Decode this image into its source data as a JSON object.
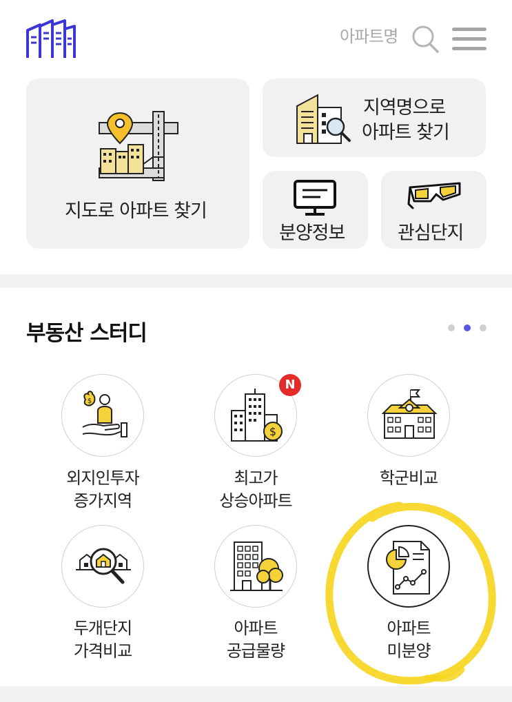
{
  "header": {
    "search_label": "아파트명",
    "logo_icon": "buildings-logo-icon",
    "search_icon": "search-icon",
    "menu_icon": "hamburger-menu-icon",
    "brand_color": "#3a35d6"
  },
  "tiles": {
    "map": {
      "label": "지도로 아파트 찾기",
      "icon": "map-pin-icon"
    },
    "region": {
      "line1": "지역명으로",
      "line2": "아파트 찾기",
      "icon": "building-magnifier-icon"
    },
    "sale_info": {
      "label": "분양정보",
      "icon": "monitor-icon"
    },
    "interest": {
      "label": "관심단지",
      "icon": "3d-glasses-icon"
    }
  },
  "study": {
    "title": "부동산 스터디",
    "page_indicator": {
      "total": 3,
      "active": 2,
      "active_color": "#5b57e6",
      "inactive_color": "#cfcfcf"
    },
    "items": [
      {
        "line1": "외지인투자",
        "line2": "증가지역",
        "icon": "investor-money-icon"
      },
      {
        "line1": "최고가",
        "line2": "상승아파트",
        "icon": "tower-coin-icon",
        "badge": "N"
      },
      {
        "line1": "학군비교",
        "line2": "",
        "icon": "school-icon"
      },
      {
        "line1": "두개단지",
        "line2": "가격비교",
        "icon": "house-magnifier-icon"
      },
      {
        "line1": "아파트",
        "line2": "공급물량",
        "icon": "apartment-tree-icon"
      },
      {
        "line1": "아파트",
        "line2": "미분양",
        "icon": "report-chart-icon"
      }
    ]
  },
  "colors": {
    "accent_yellow": "#f5d13a",
    "highlight_marker": "#f7d51d",
    "badge_red": "#e52a2a"
  }
}
